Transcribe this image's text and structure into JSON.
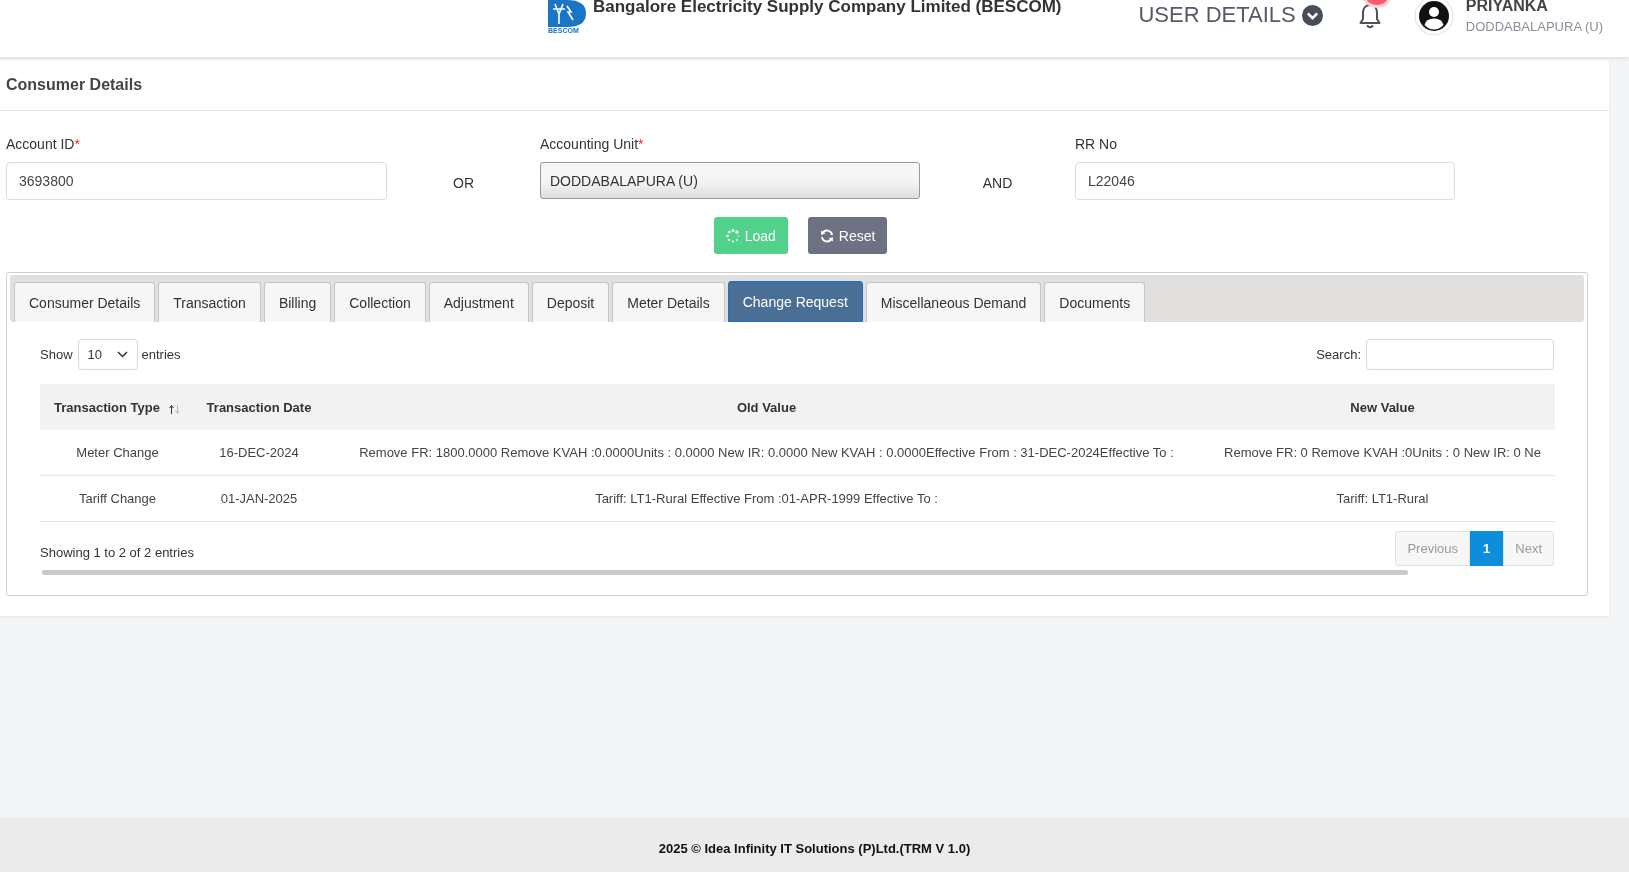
{
  "header": {
    "logo_text": "BESCOM",
    "title": "Bangalore Electricity Supply Company Limited (BESCOM)",
    "user_menu": "USER DETAILS",
    "notifications": {
      "unread": true
    },
    "user": {
      "name": "PRIYANKA",
      "unit": "DODDABALAPURA (U)"
    }
  },
  "consumer_details": {
    "title": "Consumer Details",
    "fields": [
      {
        "kind": "input",
        "label": "Account ID",
        "required_mark": "*",
        "value": "3693800"
      },
      {
        "kind": "conjunction",
        "text": "OR"
      },
      {
        "kind": "select",
        "label": "Accounting Unit",
        "required_mark": "*",
        "value": "DODDABALAPURA (U)"
      },
      {
        "kind": "conjunction",
        "text": "AND"
      },
      {
        "kind": "input",
        "label": "RR No",
        "value": "L22046"
      }
    ],
    "buttons": [
      {
        "kind": "load",
        "label": "Load"
      },
      {
        "kind": "reset",
        "label": "Reset"
      }
    ]
  },
  "tabs": [
    {
      "label": "Consumer Details",
      "selected": false
    },
    {
      "label": "Transaction",
      "selected": false
    },
    {
      "label": "Billing",
      "selected": false
    },
    {
      "label": "Collection",
      "selected": false
    },
    {
      "label": "Adjustment",
      "selected": false
    },
    {
      "label": "Deposit",
      "selected": false
    },
    {
      "label": "Meter Details",
      "selected": false
    },
    {
      "label": "Change Request",
      "selected": true
    },
    {
      "label": "Miscellaneous Demand",
      "selected": false
    },
    {
      "label": "Documents",
      "selected": false
    }
  ],
  "table": {
    "length_menu": {
      "before": "Show",
      "value": "10",
      "after": "entries"
    },
    "search": {
      "label": "Search:"
    },
    "columns": [
      {
        "label": "Transaction Type",
        "sortable": true
      },
      {
        "label": "Transaction Date",
        "sortable": false
      },
      {
        "label": "Old Value",
        "sortable": false
      },
      {
        "label": "New Value",
        "sortable": false
      }
    ],
    "rows": [
      [
        "Meter Change",
        "16-DEC-2024",
        "Remove FR: 1800.0000 Remove KVAH :0.0000Units : 0.0000 New IR: 0.0000 New KVAH : 0.0000Effective From : 31-DEC-2024Effective To :",
        "Remove FR: 0 Remove KVAH :0Units : 0 New IR: 0 Ne"
      ],
      [
        "Tariff Change",
        "01-JAN-2025",
        "Tariff: LT1-Rural Effective From :01-APR-1999 Effective To :",
        "Tariff: LT1-Rural"
      ]
    ],
    "info": "Showing 1 to 2 of 2 entries",
    "pagination": [
      {
        "kind": "nav",
        "label": "Previous",
        "disabled": true,
        "selected": false
      },
      {
        "kind": "page",
        "label": "1",
        "disabled": false,
        "selected": true
      },
      {
        "kind": "nav",
        "label": "Next",
        "disabled": true,
        "selected": false
      }
    ]
  },
  "footer": "2025 © Idea Infinity IT Solutions (P)Ltd.(TRM V 1.0)"
}
